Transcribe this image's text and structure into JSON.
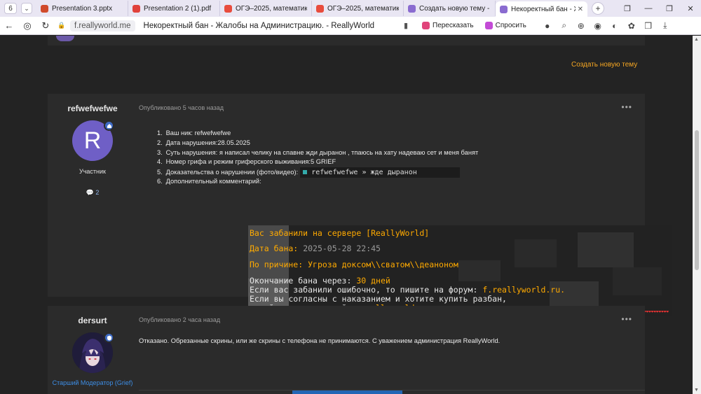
{
  "browser": {
    "tab_counter": "6",
    "tabs": [
      {
        "title": "Presentation 3.pptx",
        "color": "#d04a2b",
        "active": false
      },
      {
        "title": "Presentation 2 (1).pdf",
        "color": "#e0413b",
        "active": false
      },
      {
        "title": "ОГЭ–2025, математика: з",
        "color": "#e84c3d",
        "active": false
      },
      {
        "title": "ОГЭ–2025, математика: з",
        "color": "#e84c3d",
        "active": false
      },
      {
        "title": "Создать новую тему - Rea",
        "color": "#8a6bd0",
        "active": false
      },
      {
        "title": "Некоректный бан - Жал",
        "color": "#8a6bd0",
        "active": true
      }
    ],
    "domain": "f.reallyworld.me",
    "page_title": "Некоректный бан - Жалобы на Администрацию. - ReallyWorld",
    "retell_label": "Пересказать",
    "ask_label": "Спросить"
  },
  "page": {
    "create_topic": "Создать новую тему",
    "posts": [
      {
        "author": "refwefwefwe",
        "avatar_letter": "R",
        "role": "Участник",
        "post_count": "2",
        "meta": "Опубликовано 5 часов назад",
        "items": [
          "Ваш ник: refwefwefwe",
          "Дата нарушения:28.05.2025",
          "Суть нарушения: я написал челику на спавне жди дыранон , тпаюсь на хату надеваю сет и меня банят",
          "Номер грифа и режим гриферского выживания:5 GRIEF",
          "Доказательства о нарушении (фото/видео):",
          "Дополнительный комментарий:"
        ],
        "inline_screenshot_text": "refwefwefwe » жде дыранон",
        "ban_screenshot": {
          "line1": "Вас забанили на сервере [ReallyWorld]",
          "line2_label": "Дата бана:",
          "line2_value": "2025-05-28 22:45",
          "line3_label": "По причине:",
          "line3_value": "Угроза доксом\\\\сватом\\\\деаноном",
          "line4_label": "Окончание бана через:",
          "line4_value": "30 дней",
          "line5_label": "Если вас забанили ошибочно, то пишите на форум:",
          "line5_value": "f.reallyworld.ru.",
          "line6": "Если вы согласны с наказанием и хотите купить разбан,",
          "line7_label": " перейдите на наш сайт:",
          "line7_value": "reallyworld.ru"
        }
      },
      {
        "author": "dersurt",
        "role": "Старший Модератор (Grief)",
        "meta": "Опубликовано 2 часа назад",
        "text": "Отказано. Обрезанные скрины, или же скрины с телефона не принимаются. С уважением администрация ReallyWorld."
      }
    ]
  }
}
